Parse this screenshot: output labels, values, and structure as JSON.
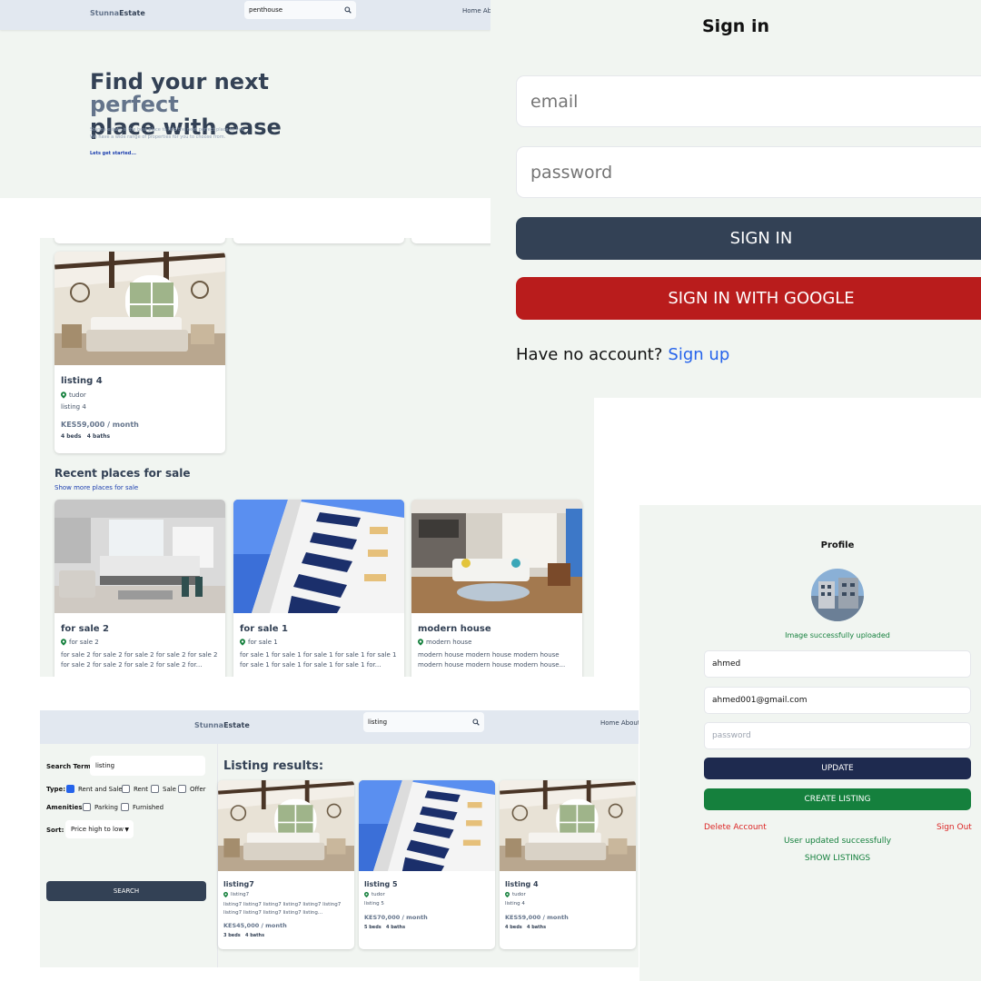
{
  "colors": {
    "slate_dark": "#334155",
    "slate": "#64748b",
    "google_red": "#b91c1c",
    "green": "#15803d",
    "navy": "#1e2a4f",
    "link_blue": "#2563eb",
    "danger": "#dc2626"
  },
  "home": {
    "logo_a": "Stunna",
    "logo_b": "Estate",
    "search_value": "penthouse",
    "nav": "Home  About",
    "title_a": "Find your next ",
    "title_hl": "perfect",
    "title_b": "place with ease",
    "subtitle_1": "Stunna estate is the best place to find the next perfect place to live.",
    "subtitle_2": "We have a wide range of properties for you to choose from.",
    "cta": "Lets get started..."
  },
  "offer_listing": {
    "title": "listing 4",
    "address": "tudor",
    "description": "listing 4",
    "price": "KES59,000 / month",
    "beds": "4 beds",
    "baths": "4 baths"
  },
  "sale_section": {
    "title": "Recent places for sale",
    "link": "Show more places for sale",
    "cards": [
      {
        "title": "for sale 2",
        "address": "for sale 2",
        "description": "for sale 2 for sale 2 for sale 2 for sale 2 for sale 2 for sale 2 for sale 2 for sale 2 for sale 2 for..."
      },
      {
        "title": "for sale 1",
        "address": "for sale 1",
        "description": "for sale 1 for sale 1 for sale 1 for sale 1 for sale 1 for sale 1 for sale 1 for sale 1 for sale 1 for..."
      },
      {
        "title": "modern house",
        "address": "modern house",
        "description": "modern house modern house modern house modern house modern house modern house..."
      }
    ]
  },
  "signin": {
    "title": "Sign in",
    "email_placeholder": "email",
    "password_placeholder": "password",
    "signin_button": "SIGN IN",
    "google_button": "SIGN IN WITH GOOGLE",
    "no_account": "Have no account?",
    "signup_link": "Sign up"
  },
  "profile": {
    "title": "Profile",
    "upload_msg": "Image successfully uploaded",
    "username": "ahmed",
    "email": "ahmed001@gmail.com",
    "password_placeholder": "password",
    "update_button": "UPDATE",
    "create_button": "CREATE LISTING",
    "delete_link": "Delete Account",
    "signout_link": "Sign Out",
    "updated_msg": "User updated successfully",
    "show_listings": "SHOW LISTINGS"
  },
  "search_page": {
    "logo_a": "Stunna",
    "logo_b": "Estate",
    "search_value": "listing",
    "nav": "Home  About",
    "term_label": "Search Term:",
    "term_value": "listing",
    "type_label": "Type:",
    "type_options": [
      "Rent and Sale",
      "Rent",
      "Sale",
      "Offer"
    ],
    "amenities_label": "Amenities:",
    "amenity_options": [
      "Parking",
      "Furnished"
    ],
    "sort_label": "Sort:",
    "sort_value": "Price high to low",
    "search_button": "SEARCH",
    "results_title": "Listing results:",
    "results": [
      {
        "title": "listing7",
        "address": "listing7",
        "description": "listing7 listing7 listing7 listing7 listing7 listing7 listing7 listing7 listing7 listing7 listing...",
        "price": "KES45,000 / month",
        "beds": "3 beds",
        "baths": "4 baths"
      },
      {
        "title": "listing 5",
        "address": "tudor",
        "description": "listing 5",
        "price": "KES70,000 / month",
        "beds": "5 beds",
        "baths": "4 baths"
      },
      {
        "title": "listing 4",
        "address": "tudor",
        "description": "listing 4",
        "price": "KES59,000 / month",
        "beds": "4 beds",
        "baths": "4 baths"
      }
    ]
  }
}
